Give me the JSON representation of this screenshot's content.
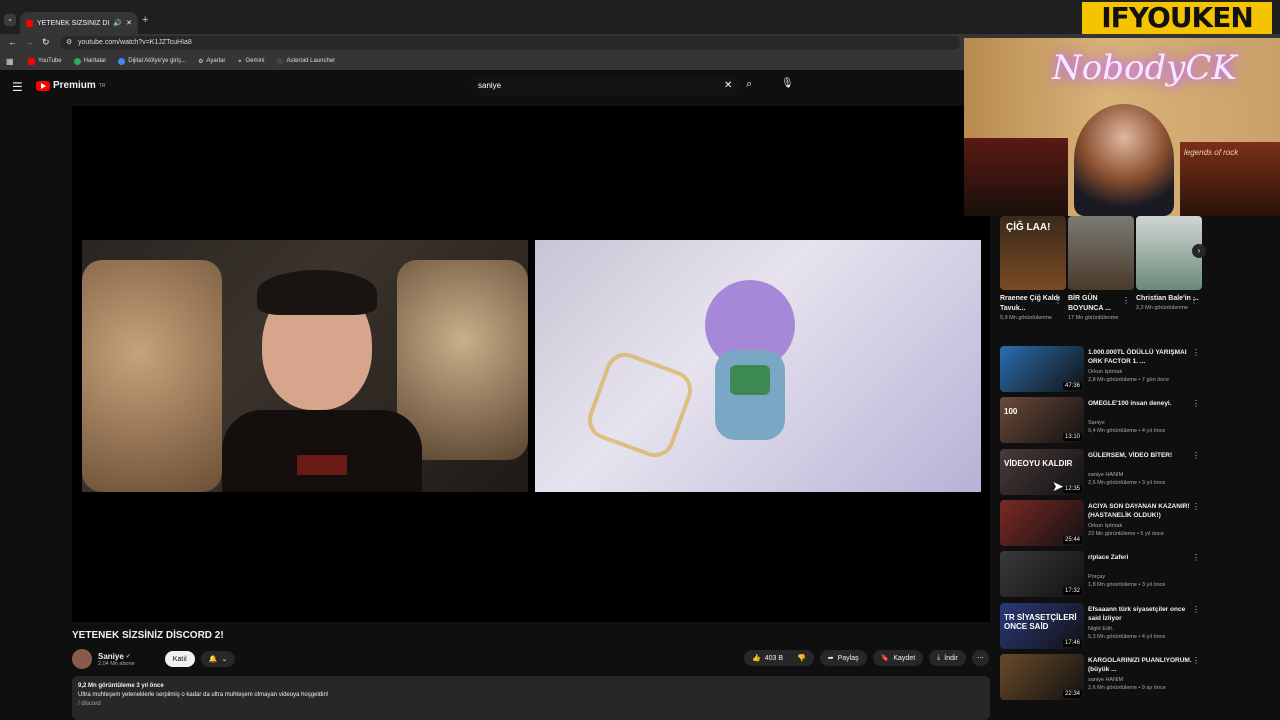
{
  "browser": {
    "tab_title": "YETENEK SİZSİNİZ DİSCORD",
    "url": "youtube.com/watch?v=K1JZTcuHIa8",
    "bookmarks": [
      "YouTube",
      "Haritalar",
      "Dijital Atölye'ye giriş...",
      "Ayarlar",
      "Gemini",
      "Asteroid Launcher"
    ]
  },
  "header": {
    "logo_text": "Premium",
    "logo_sup": "TR",
    "search_value": "saniye"
  },
  "video": {
    "title": "YETENEK SİZSİNİZ DİSCORD 2!",
    "channel": "Saniye",
    "subscribers": "2,04 Mn abone",
    "join_label": "Katıl",
    "likes": "403 B",
    "share_label": "Paylaş",
    "save_label": "Kaydet",
    "download_label": "İndir",
    "views_date": "9,2 Mn görüntüleme  3 yıl önce",
    "description": "Ultra muhteşem yeteneklerle serpilmiş o kadar da ultra muhteşem olmayan videoya hoşgeldin!",
    "desc_link": "/ discord"
  },
  "shorts": [
    {
      "title": "Rraenee Çiğ Kaldı Tavuk...",
      "views": "5,9 Mn görüntülenme",
      "overlay": "ÇİĞ LAA!"
    },
    {
      "title": "BİR GÜN BOYUNCA ...",
      "views": "17 Mn görüntülenme",
      "overlay": ""
    },
    {
      "title": "Christian Bale'in ...",
      "views": "2,2 Mn görüntülenme",
      "overlay": ""
    }
  ],
  "recommendations": [
    {
      "title": "1.000.000TL ÖDÜLLÜ YARIŞMAI ORK FACTOR 1. ...",
      "channel": "Orkun Işıtmak",
      "meta": "2,8 Mn görüntüleme • 7 gün önce",
      "duration": "47:36",
      "color": "#2a6fb0",
      "overlay": ""
    },
    {
      "title": "OMEGLE'100 insan deneyi.",
      "channel": "Saniye",
      "meta": "9,4 Mn görüntüleme • 4 yıl önce",
      "duration": "13:10",
      "color": "#6b4a3a",
      "overlay": "100"
    },
    {
      "title": "GÜLERSEM, VİDEO BİTER!",
      "channel": "saniye HANIM",
      "meta": "2,6 Mn görüntüleme • 3 yıl önce",
      "duration": "12:35",
      "color": "#4a3a3a",
      "overlay": "VİDEOYU KALDIR"
    },
    {
      "title": "ACIYA SON DAYANAN KAZANIR! (HASTANELİK OLDUK!)",
      "channel": "Orkun Işıtmak",
      "meta": "23 Mn görüntüleme • 5 yıl önce",
      "duration": "25:44",
      "color": "#7a2a24",
      "overlay": ""
    },
    {
      "title": "r/place Zaferi",
      "channel": "Porçay",
      "meta": "1,8 Mn görüntüleme • 3 yıl önce",
      "duration": "17:32",
      "color": "#3a3a3a",
      "overlay": ""
    },
    {
      "title": "Efsaaann türk siyasetçiler once said İzliyor",
      "channel": "Night Edit.",
      "meta": "5,3 Mn görüntüleme • 4 yıl önce",
      "duration": "17:46",
      "color": "#2a3a7a",
      "overlay": "TR SİYASETÇİLERİ ONCE SAİD"
    },
    {
      "title": "KARGOLARINIZI PUANLIYORUM. (büyük ...",
      "channel": "saniye HANIM",
      "meta": "2,6 Mn görüntüleme • 9 ay önce",
      "duration": "22:34",
      "color": "#6a4a2a",
      "overlay": ""
    }
  ],
  "overlay": {
    "brand": "IFYOUKEN",
    "neon_sign": "NobodyCK",
    "poster": "legends of rock"
  }
}
